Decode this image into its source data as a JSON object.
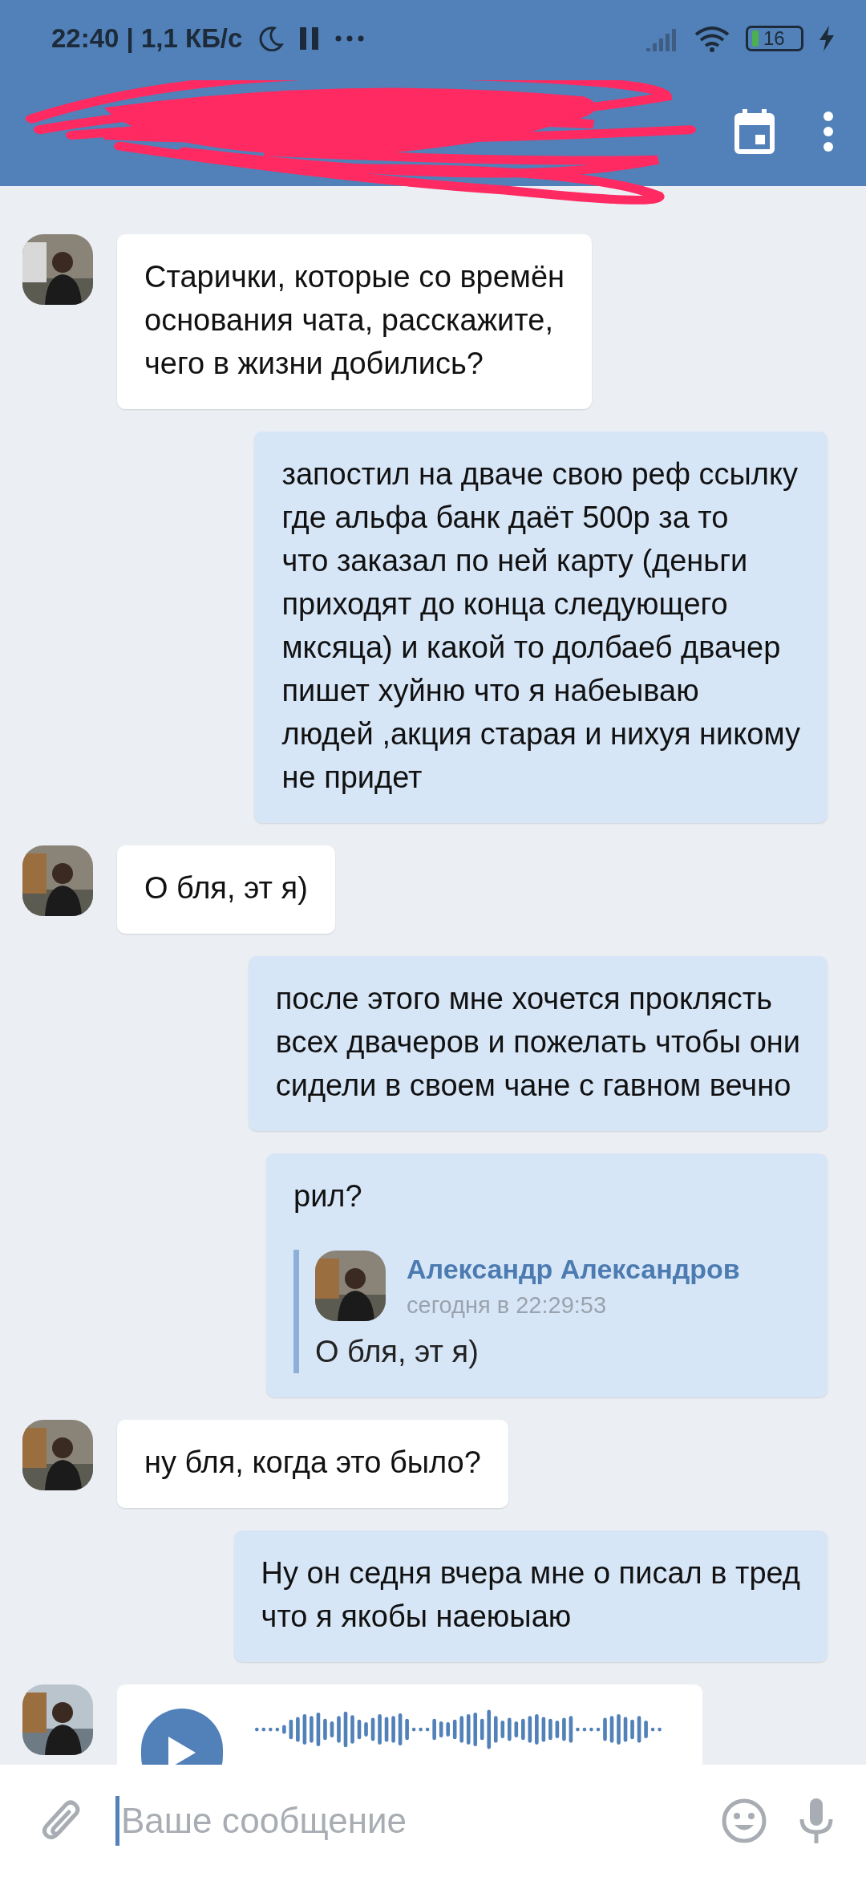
{
  "status_bar": {
    "time": "22:40 | 1,1 КБ/с",
    "battery": "16"
  },
  "messages": [
    {
      "kind": "text",
      "outgoing": false,
      "text": "Старички, которые со времён\nоснования чата, расскажите,\nчего в жизни добились?"
    },
    {
      "kind": "text",
      "outgoing": true,
      "text": "запостил на дваче свою реф ссылку\nгде альфа банк даёт 500р за то\nчто заказал по ней карту (деньги\nприходят до конца следующего\nмксяца) и какой то долбаеб двачер\nпишет хуйню что я набеываю\nлюдей ,акция старая и нихуя никому\nне придет"
    },
    {
      "kind": "text",
      "outgoing": false,
      "text": "О бля, эт я)"
    },
    {
      "kind": "text",
      "outgoing": true,
      "text": "после этого мне хочется проклясть\nвсех двачеров и пожелать чтобы они\nсидели в своем чане с гавном вечно"
    },
    {
      "kind": "reply",
      "outgoing": true,
      "text": "рил?",
      "quote": {
        "author": "Александр Александров",
        "time": "сегодня в 22:29:53",
        "text": "О бля, эт я)"
      }
    },
    {
      "kind": "text",
      "outgoing": false,
      "text": "ну бля, когда это было?"
    },
    {
      "kind": "text",
      "outgoing": true,
      "text": "Ну он седня вчера мне о писал в тред\nчто я якобы наеюыаю"
    },
    {
      "kind": "voice",
      "outgoing": false
    }
  ],
  "composer": {
    "placeholder": "Ваше сообщение"
  }
}
